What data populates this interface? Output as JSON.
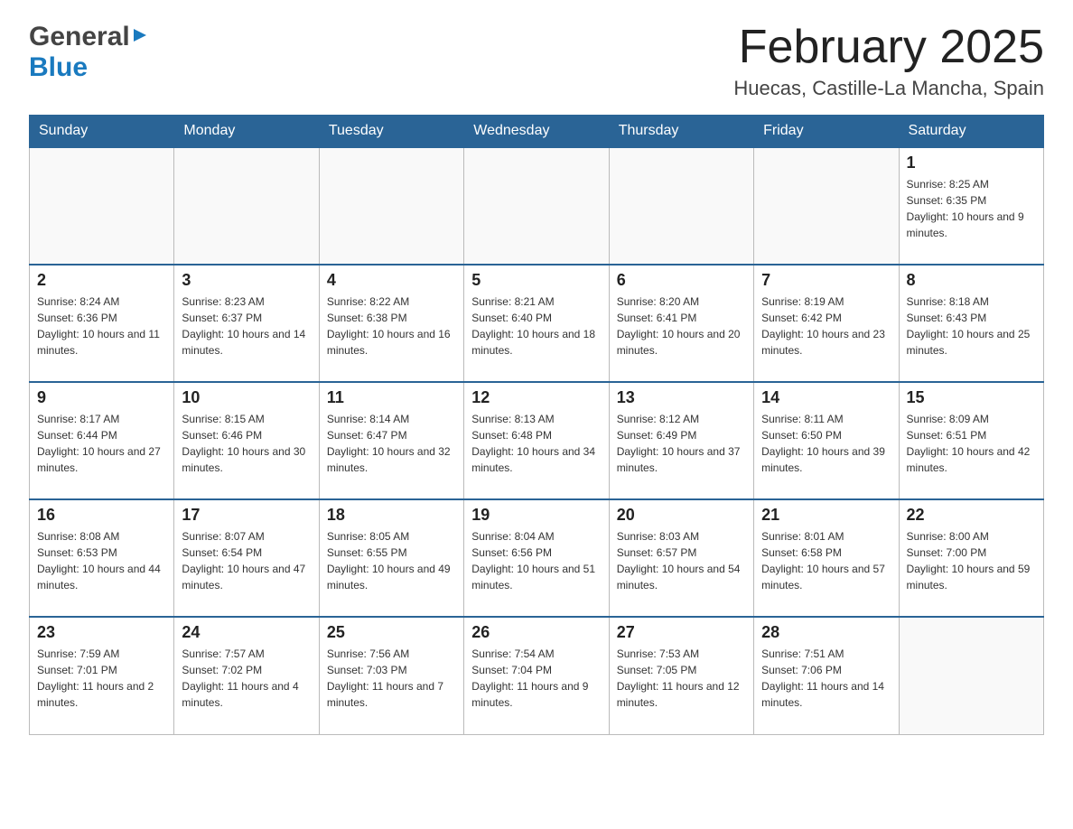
{
  "header": {
    "logo_general": "General",
    "logo_blue": "Blue",
    "month_title": "February 2025",
    "location": "Huecas, Castille-La Mancha, Spain"
  },
  "calendar": {
    "days_of_week": [
      "Sunday",
      "Monday",
      "Tuesday",
      "Wednesday",
      "Thursday",
      "Friday",
      "Saturday"
    ],
    "weeks": [
      {
        "days": [
          {
            "number": "",
            "info": ""
          },
          {
            "number": "",
            "info": ""
          },
          {
            "number": "",
            "info": ""
          },
          {
            "number": "",
            "info": ""
          },
          {
            "number": "",
            "info": ""
          },
          {
            "number": "",
            "info": ""
          },
          {
            "number": "1",
            "info": "Sunrise: 8:25 AM\nSunset: 6:35 PM\nDaylight: 10 hours and 9 minutes."
          }
        ]
      },
      {
        "days": [
          {
            "number": "2",
            "info": "Sunrise: 8:24 AM\nSunset: 6:36 PM\nDaylight: 10 hours and 11 minutes."
          },
          {
            "number": "3",
            "info": "Sunrise: 8:23 AM\nSunset: 6:37 PM\nDaylight: 10 hours and 14 minutes."
          },
          {
            "number": "4",
            "info": "Sunrise: 8:22 AM\nSunset: 6:38 PM\nDaylight: 10 hours and 16 minutes."
          },
          {
            "number": "5",
            "info": "Sunrise: 8:21 AM\nSunset: 6:40 PM\nDaylight: 10 hours and 18 minutes."
          },
          {
            "number": "6",
            "info": "Sunrise: 8:20 AM\nSunset: 6:41 PM\nDaylight: 10 hours and 20 minutes."
          },
          {
            "number": "7",
            "info": "Sunrise: 8:19 AM\nSunset: 6:42 PM\nDaylight: 10 hours and 23 minutes."
          },
          {
            "number": "8",
            "info": "Sunrise: 8:18 AM\nSunset: 6:43 PM\nDaylight: 10 hours and 25 minutes."
          }
        ]
      },
      {
        "days": [
          {
            "number": "9",
            "info": "Sunrise: 8:17 AM\nSunset: 6:44 PM\nDaylight: 10 hours and 27 minutes."
          },
          {
            "number": "10",
            "info": "Sunrise: 8:15 AM\nSunset: 6:46 PM\nDaylight: 10 hours and 30 minutes."
          },
          {
            "number": "11",
            "info": "Sunrise: 8:14 AM\nSunset: 6:47 PM\nDaylight: 10 hours and 32 minutes."
          },
          {
            "number": "12",
            "info": "Sunrise: 8:13 AM\nSunset: 6:48 PM\nDaylight: 10 hours and 34 minutes."
          },
          {
            "number": "13",
            "info": "Sunrise: 8:12 AM\nSunset: 6:49 PM\nDaylight: 10 hours and 37 minutes."
          },
          {
            "number": "14",
            "info": "Sunrise: 8:11 AM\nSunset: 6:50 PM\nDaylight: 10 hours and 39 minutes."
          },
          {
            "number": "15",
            "info": "Sunrise: 8:09 AM\nSunset: 6:51 PM\nDaylight: 10 hours and 42 minutes."
          }
        ]
      },
      {
        "days": [
          {
            "number": "16",
            "info": "Sunrise: 8:08 AM\nSunset: 6:53 PM\nDaylight: 10 hours and 44 minutes."
          },
          {
            "number": "17",
            "info": "Sunrise: 8:07 AM\nSunset: 6:54 PM\nDaylight: 10 hours and 47 minutes."
          },
          {
            "number": "18",
            "info": "Sunrise: 8:05 AM\nSunset: 6:55 PM\nDaylight: 10 hours and 49 minutes."
          },
          {
            "number": "19",
            "info": "Sunrise: 8:04 AM\nSunset: 6:56 PM\nDaylight: 10 hours and 51 minutes."
          },
          {
            "number": "20",
            "info": "Sunrise: 8:03 AM\nSunset: 6:57 PM\nDaylight: 10 hours and 54 minutes."
          },
          {
            "number": "21",
            "info": "Sunrise: 8:01 AM\nSunset: 6:58 PM\nDaylight: 10 hours and 57 minutes."
          },
          {
            "number": "22",
            "info": "Sunrise: 8:00 AM\nSunset: 7:00 PM\nDaylight: 10 hours and 59 minutes."
          }
        ]
      },
      {
        "days": [
          {
            "number": "23",
            "info": "Sunrise: 7:59 AM\nSunset: 7:01 PM\nDaylight: 11 hours and 2 minutes."
          },
          {
            "number": "24",
            "info": "Sunrise: 7:57 AM\nSunset: 7:02 PM\nDaylight: 11 hours and 4 minutes."
          },
          {
            "number": "25",
            "info": "Sunrise: 7:56 AM\nSunset: 7:03 PM\nDaylight: 11 hours and 7 minutes."
          },
          {
            "number": "26",
            "info": "Sunrise: 7:54 AM\nSunset: 7:04 PM\nDaylight: 11 hours and 9 minutes."
          },
          {
            "number": "27",
            "info": "Sunrise: 7:53 AM\nSunset: 7:05 PM\nDaylight: 11 hours and 12 minutes."
          },
          {
            "number": "28",
            "info": "Sunrise: 7:51 AM\nSunset: 7:06 PM\nDaylight: 11 hours and 14 minutes."
          },
          {
            "number": "",
            "info": ""
          }
        ]
      }
    ]
  }
}
